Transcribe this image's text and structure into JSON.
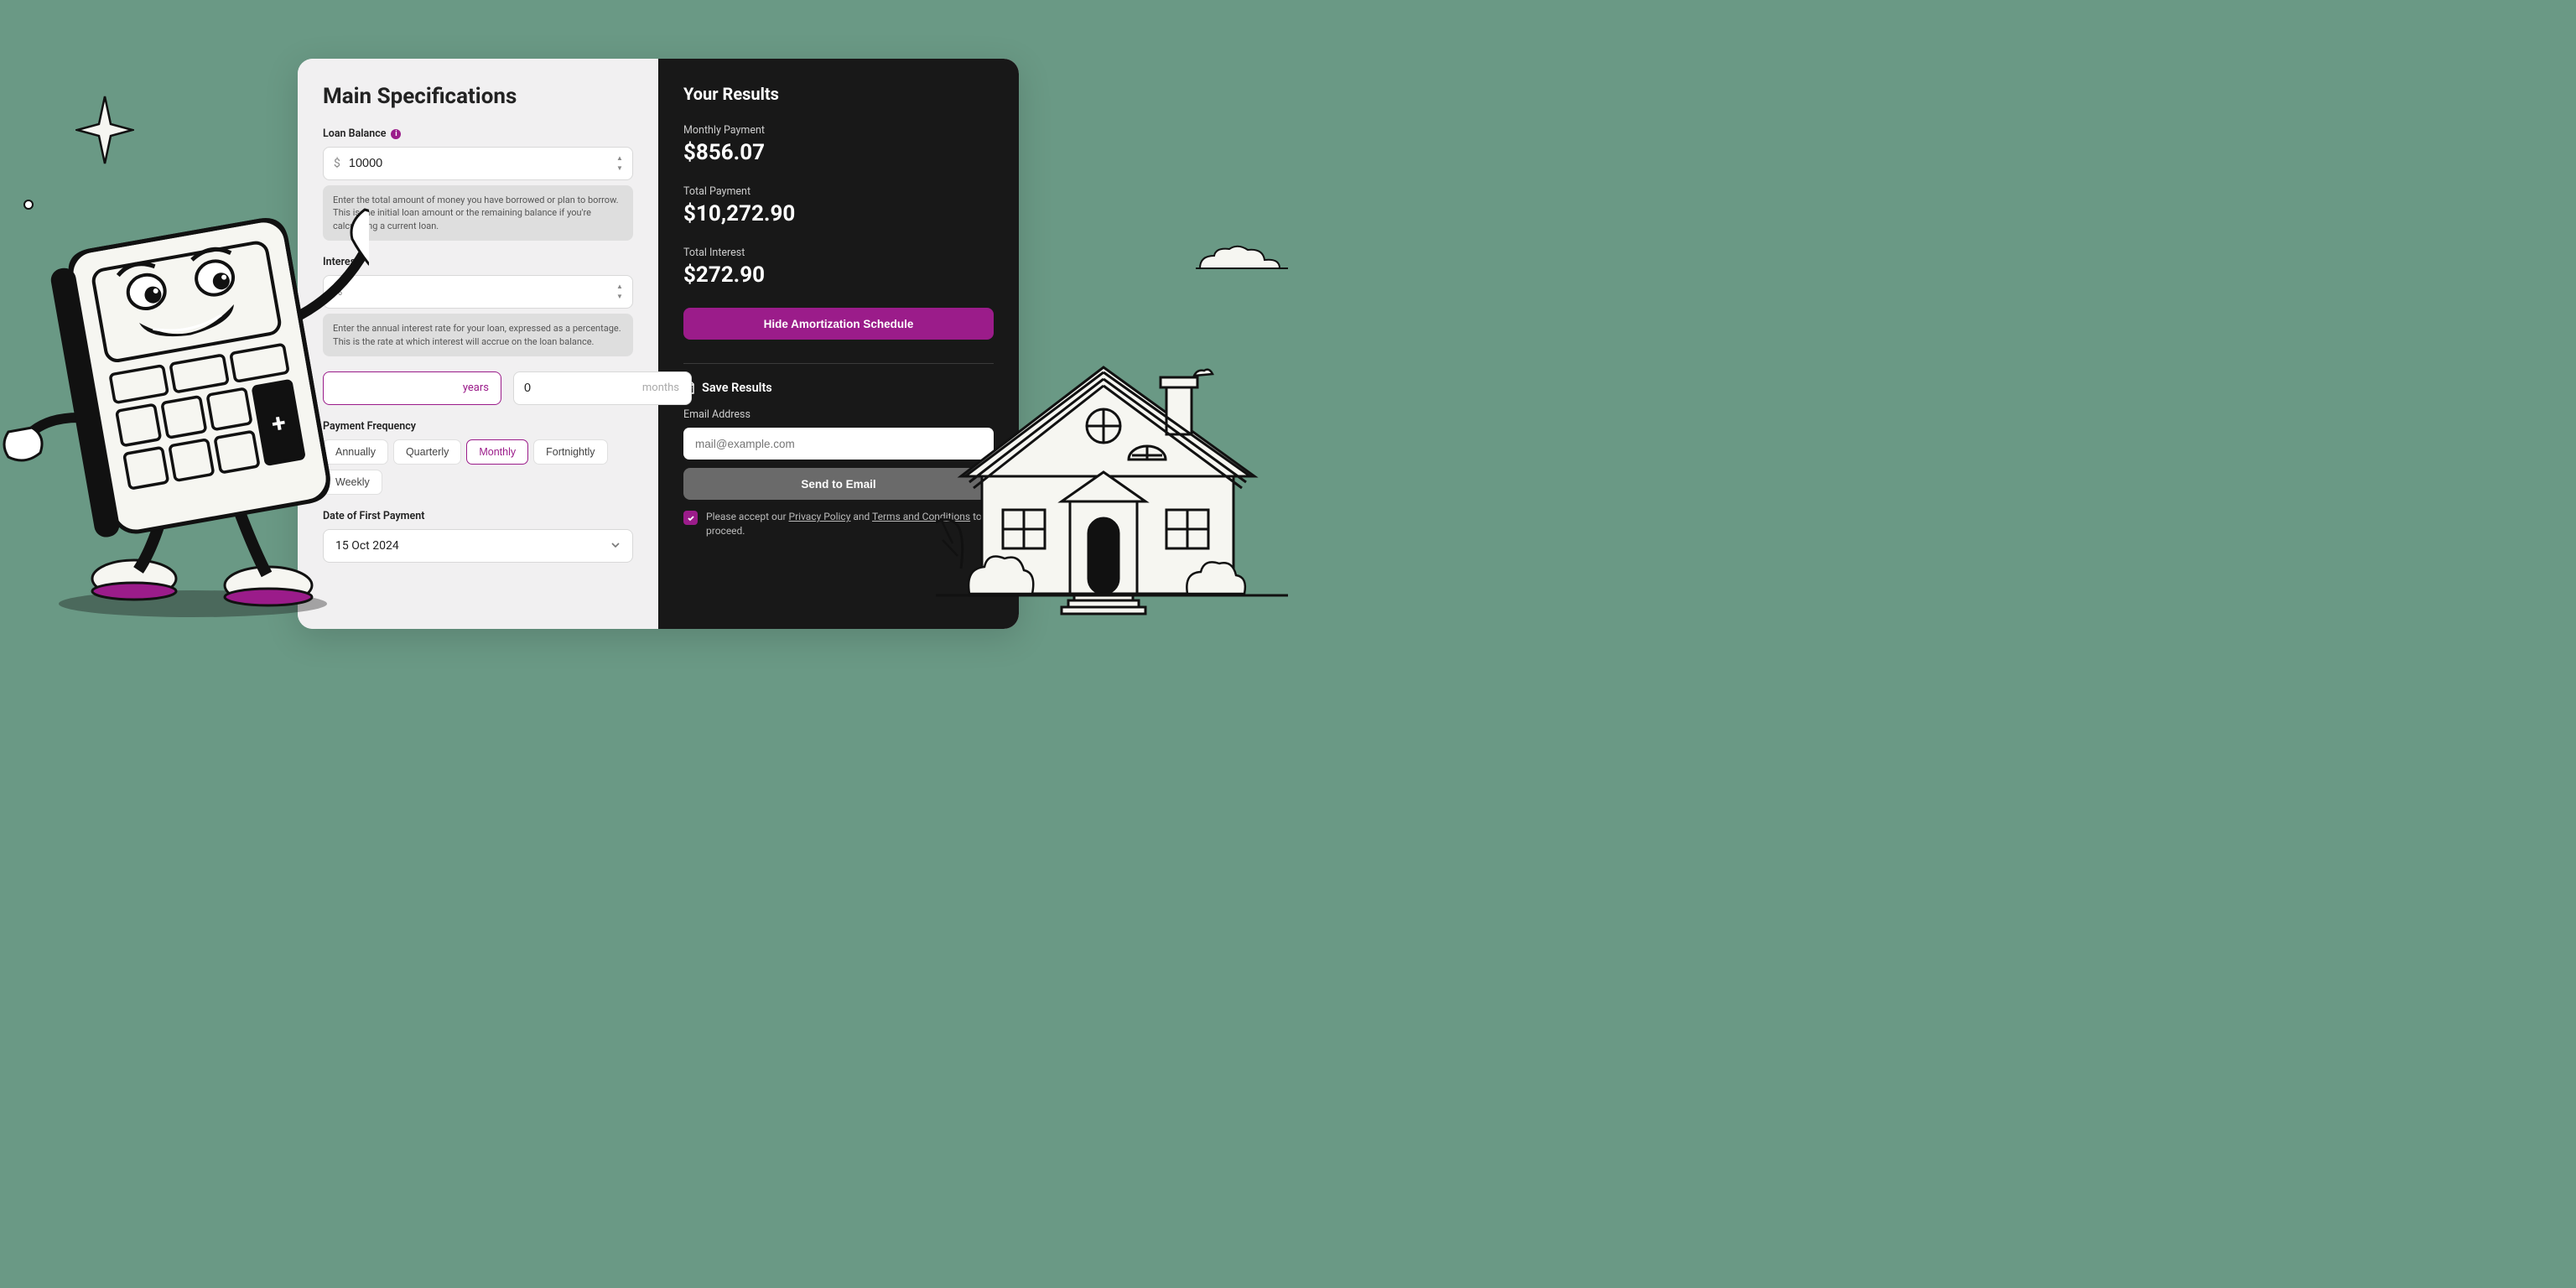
{
  "left": {
    "title": "Main Specifications",
    "loan": {
      "label": "Loan Balance",
      "value": "10000",
      "help": "Enter the total amount of money you have borrowed or plan to borrow. This is the initial loan amount or the remaining balance if you're calculating a current loan.",
      "prefix": "$"
    },
    "interest": {
      "label": "Interest",
      "prefix": "%",
      "help": "Enter the annual interest rate for your loan, expressed as a percentage. This is the rate at which interest will accrue on the loan balance."
    },
    "term": {
      "years_value": "",
      "years_suffix": "years",
      "months_value": "0",
      "months_suffix": "months"
    },
    "frequency": {
      "label": "Payment Frequency",
      "options": [
        "Annually",
        "Quarterly",
        "Monthly",
        "Fortnightly",
        "Weekly"
      ],
      "selected": "Monthly"
    },
    "date": {
      "label": "Date of First Payment",
      "value": "15 Oct 2024"
    }
  },
  "right": {
    "title": "Your Results",
    "monthly_label": "Monthly Payment",
    "monthly_value": "$856.07",
    "total_label": "Total Payment",
    "total_value": "$10,272.90",
    "interest_label": "Total Interest",
    "interest_value": "$272.90",
    "schedule_btn": "Hide Amortization Schedule",
    "save_title": "Save Results",
    "email_label": "Email Address",
    "email_placeholder": "mail@example.com",
    "send_btn": "Send to Email",
    "consent_pre": "Please accept our ",
    "consent_privacy": "Privacy Policy",
    "consent_mid": " and ",
    "consent_terms": "Terms and Conditions",
    "consent_post": " to proceed."
  }
}
